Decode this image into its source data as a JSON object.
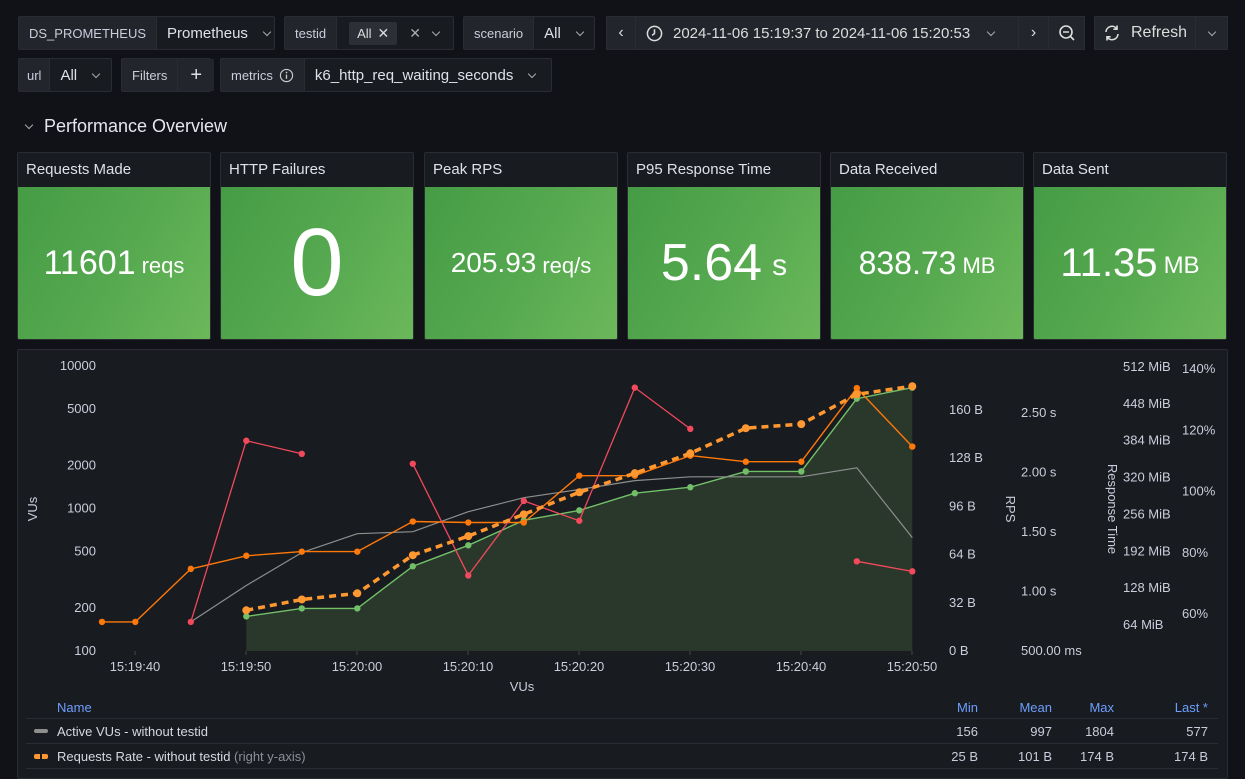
{
  "toolbar": {
    "datasource": {
      "label": "DS_PROMETHEUS",
      "value": "Prometheus"
    },
    "testid": {
      "label": "testid",
      "chip": "All"
    },
    "scenario": {
      "label": "scenario",
      "value": "All"
    },
    "url": {
      "label": "url",
      "value": "All"
    },
    "filters": {
      "label": "Filters",
      "add": "+"
    },
    "metrics": {
      "label": "metrics",
      "value": "k6_http_req_waiting_seconds"
    },
    "time_range": "2024-11-06 15:19:37 to 2024-11-06 15:20:53",
    "refresh_label": "Refresh"
  },
  "section": {
    "title": "Performance Overview"
  },
  "stats": [
    {
      "title": "Requests Made",
      "value": "11601",
      "unit": "reqs"
    },
    {
      "title": "HTTP Failures",
      "value": "0",
      "unit": ""
    },
    {
      "title": "Peak RPS",
      "value": "205.93",
      "unit": "req/s"
    },
    {
      "title": "P95 Response Time",
      "value": "5.64",
      "unit": "s"
    },
    {
      "title": "Data Received",
      "value": "838.73",
      "unit": "MB"
    },
    {
      "title": "Data Sent",
      "value": "11.35",
      "unit": "MB"
    }
  ],
  "colors": {
    "active_vus": "#8e8e8e",
    "requests_rate": "#ff9830",
    "orange_series": "#ff780a",
    "pink_series": "#f2495c",
    "green_series": "#73bf69",
    "stat_green": "#56a64b",
    "legend_header": "#6e9fff"
  },
  "chart_data": {
    "type": "line",
    "xlabel": "VUs",
    "ylabel": "VUs",
    "x_ticks": [
      "15:19:40",
      "15:19:50",
      "15:20:00",
      "15:20:10",
      "15:20:20",
      "15:20:30",
      "15:20:40",
      "15:20:50"
    ],
    "y_left": {
      "scale": "log",
      "ticks": [
        "10000",
        "5000",
        "2000",
        "1000",
        "500",
        "200",
        "100"
      ],
      "range": [
        100,
        10000
      ]
    },
    "y_right_axes": [
      {
        "label": "RPS",
        "ticks": [
          "160 B",
          "128 B",
          "96 B",
          "64 B",
          "32 B",
          "0 B"
        ]
      },
      {
        "label": "Response Time",
        "ticks": [
          "2.50 s",
          "2.00 s",
          "1.50 s",
          "1.00 s",
          "500.00 ms"
        ]
      },
      {
        "label": "",
        "ticks": [
          "512 MiB",
          "448 MiB",
          "384 MiB",
          "320 MiB",
          "256 MiB",
          "192 MiB",
          "128 MiB",
          "64 MiB"
        ]
      },
      {
        "label": "",
        "ticks": [
          "140%",
          "120%",
          "100%",
          "80%",
          "60%"
        ]
      }
    ],
    "x_seconds_from_start": "seconds after 15:19:37",
    "series": [
      {
        "name": "orange",
        "style": "solid-points",
        "points": [
          [
            0,
            160
          ],
          [
            3,
            160
          ],
          [
            8,
            377
          ],
          [
            13,
            466
          ],
          [
            18,
            498
          ],
          [
            23,
            498
          ],
          [
            28,
            810
          ],
          [
            33,
            797
          ],
          [
            38,
            797
          ],
          [
            43,
            1700
          ],
          [
            48,
            1700
          ],
          [
            53,
            2350
          ],
          [
            58,
            2130
          ],
          [
            63,
            2130
          ],
          [
            68,
            7000
          ],
          [
            73,
            2720
          ]
        ]
      },
      {
        "name": "pink-a",
        "style": "solid-points",
        "points": [
          [
            8,
            160
          ],
          [
            13,
            2990
          ],
          [
            18,
            2420
          ]
        ]
      },
      {
        "name": "pink-b",
        "style": "solid-points",
        "points": [
          [
            28,
            2060
          ],
          [
            33,
            339
          ],
          [
            38,
            1130
          ],
          [
            43,
            820
          ],
          [
            48,
            7050
          ],
          [
            53,
            3620
          ]
        ]
      },
      {
        "name": "pink-c",
        "style": "solid-points",
        "points": [
          [
            68,
            426
          ],
          [
            73,
            362
          ]
        ]
      },
      {
        "name": "Active VUs - without testid",
        "style": "solid",
        "points": [
          [
            8,
            160
          ],
          [
            13,
            288
          ],
          [
            18,
            490
          ],
          [
            23,
            665
          ],
          [
            28,
            687
          ],
          [
            33,
            950
          ],
          [
            38,
            1190
          ],
          [
            43,
            1360
          ],
          [
            48,
            1570
          ],
          [
            53,
            1670
          ],
          [
            58,
            1670
          ],
          [
            63,
            1670
          ],
          [
            68,
            1930
          ],
          [
            73,
            625
          ]
        ]
      },
      {
        "name": "green",
        "style": "area-points",
        "points": [
          [
            13,
            175
          ],
          [
            18,
            199
          ],
          [
            23,
            199
          ],
          [
            28,
            393
          ],
          [
            33,
            552
          ],
          [
            38,
            826
          ],
          [
            43,
            970
          ],
          [
            48,
            1280
          ],
          [
            53,
            1410
          ],
          [
            58,
            1820
          ],
          [
            63,
            1820
          ],
          [
            68,
            5900
          ],
          [
            73,
            7050
          ]
        ]
      },
      {
        "name": "Requests Rate - without testid",
        "style": "dashed-points",
        "axis": "right",
        "points": [
          [
            13,
            193
          ],
          [
            18,
            230
          ],
          [
            23,
            254
          ],
          [
            28,
            470
          ],
          [
            33,
            640
          ],
          [
            38,
            910
          ],
          [
            43,
            1300
          ],
          [
            48,
            1770
          ],
          [
            53,
            2440
          ],
          [
            58,
            3660
          ],
          [
            63,
            3910
          ],
          [
            68,
            6330
          ],
          [
            73,
            7210
          ]
        ]
      }
    ]
  },
  "legend": {
    "headers": {
      "name": "Name",
      "min": "Min",
      "mean": "Mean",
      "max": "Max",
      "last": "Last *"
    },
    "rows": [
      {
        "name": "Active VUs - without testid",
        "suffix": "",
        "min": "156",
        "mean": "997",
        "max": "1804",
        "last": "577"
      },
      {
        "name": "Requests Rate - without testid",
        "suffix": "(right y-axis)",
        "min": "25 B",
        "mean": "101 B",
        "max": "174 B",
        "last": "174 B"
      }
    ]
  }
}
